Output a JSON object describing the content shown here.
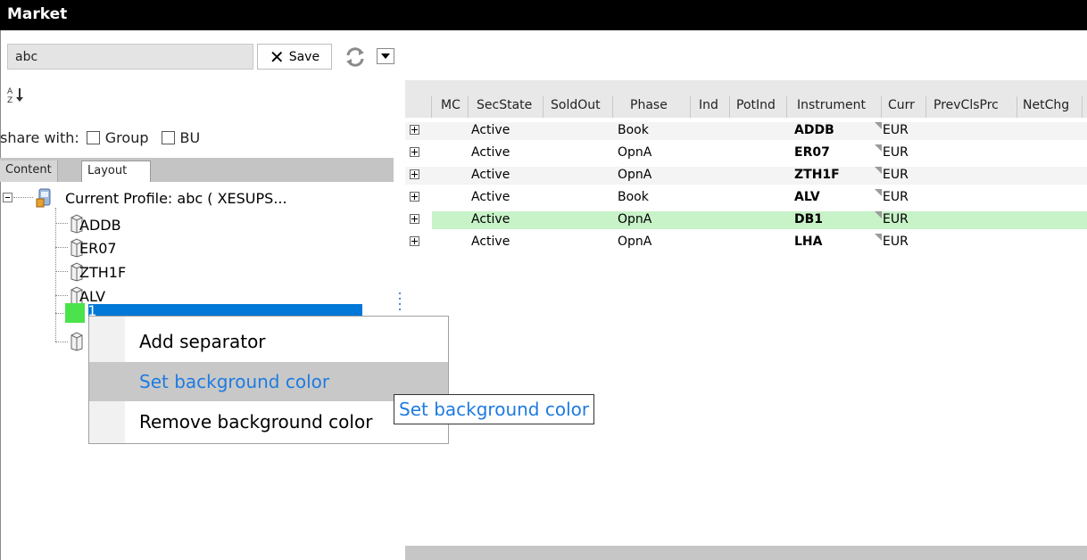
{
  "window": {
    "title": "Market"
  },
  "toolbar": {
    "search_value": "abc",
    "save_label": "Save",
    "icons": [
      "close-x-icon",
      "refresh-icon",
      "dropdown-arrow-icon",
      "sort-az-icon"
    ]
  },
  "share": {
    "label": "share with:",
    "options": [
      "Group",
      "BU"
    ]
  },
  "tabs": {
    "content": "Content",
    "layout": "Layout"
  },
  "tree": {
    "profile": "Current Profile: abc ( XESUPS...",
    "items": [
      "ADDB",
      "ER07",
      "ZTH1F",
      "ALV",
      "DB1"
    ]
  },
  "context_menu": {
    "items": [
      "Add separator",
      "Set background color",
      "Remove background color"
    ],
    "highlighted": "Set background color"
  },
  "tooltip": {
    "text": "Set background color"
  },
  "grid": {
    "columns": [
      "MC",
      "SecState",
      "SoldOut",
      "Phase",
      "Ind",
      "PotInd",
      "Instrument",
      "Curr",
      "PrevClsPrc",
      "NetChg"
    ],
    "rows": [
      {
        "secstate": "Active",
        "phase": "Book",
        "instrument": "ADDB",
        "curr": "EUR"
      },
      {
        "secstate": "Active",
        "phase": "OpnA",
        "instrument": "ER07",
        "curr": "EUR"
      },
      {
        "secstate": "Active",
        "phase": "OpnA",
        "instrument": "ZTH1F",
        "curr": "EUR"
      },
      {
        "secstate": "Active",
        "phase": "Book",
        "instrument": "ALV",
        "curr": "EUR"
      },
      {
        "secstate": "Active",
        "phase": "OpnA",
        "instrument": "DB1",
        "curr": "EUR"
      },
      {
        "secstate": "Active",
        "phase": "OpnA",
        "instrument": "LHA",
        "curr": "EUR"
      }
    ]
  },
  "colors": {
    "row_highlight": "#c8f2c8",
    "swatch_green": "#4be34b",
    "selection_blue": "#0078d7",
    "link_blue": "#1e7be0"
  }
}
